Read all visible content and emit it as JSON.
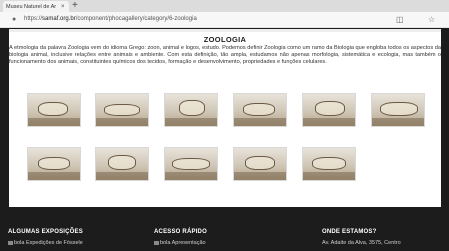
{
  "browser": {
    "tab_title": "Museu Naturel de Ar",
    "tab_close": "×",
    "new_tab": "+",
    "url_prefix": "https://",
    "url_host": "samaf.org.br",
    "url_path": "/component/phocagallery/category/6-zoologia"
  },
  "page": {
    "title": "ZOOLOGIA",
    "description": "A etmologia da palavra Zoologia vem do idioma Grego: zoon, animal e logos, estudo. Podemos definir Zoologia como um ramo da Biologia que engloba todos os aspectos da biologia animal, inclusive relações entre animais e ambiente. Com esta definição, tão ampla, estudamos não apenas morfologia, sistemática e ecologia, mas também o funcionamento dos animais, constituintes químicos dos tecidos, formação e desenvolvimento, propriedades e funções celulares."
  },
  "gallery": {
    "thumbnail_count": 11
  },
  "footer": {
    "col1_heading": "ALGUMAS EXPOSIÇÕES",
    "col1_item": "Expedições de Fóssele",
    "col2_heading": "ACESSO RÁPIDO",
    "col2_item": "Apresentação",
    "col3_heading": "ONDE ESTAMOS?",
    "col3_item": "Av. Adaite da Alva, 3575, Centro",
    "image_alt": "bola"
  }
}
